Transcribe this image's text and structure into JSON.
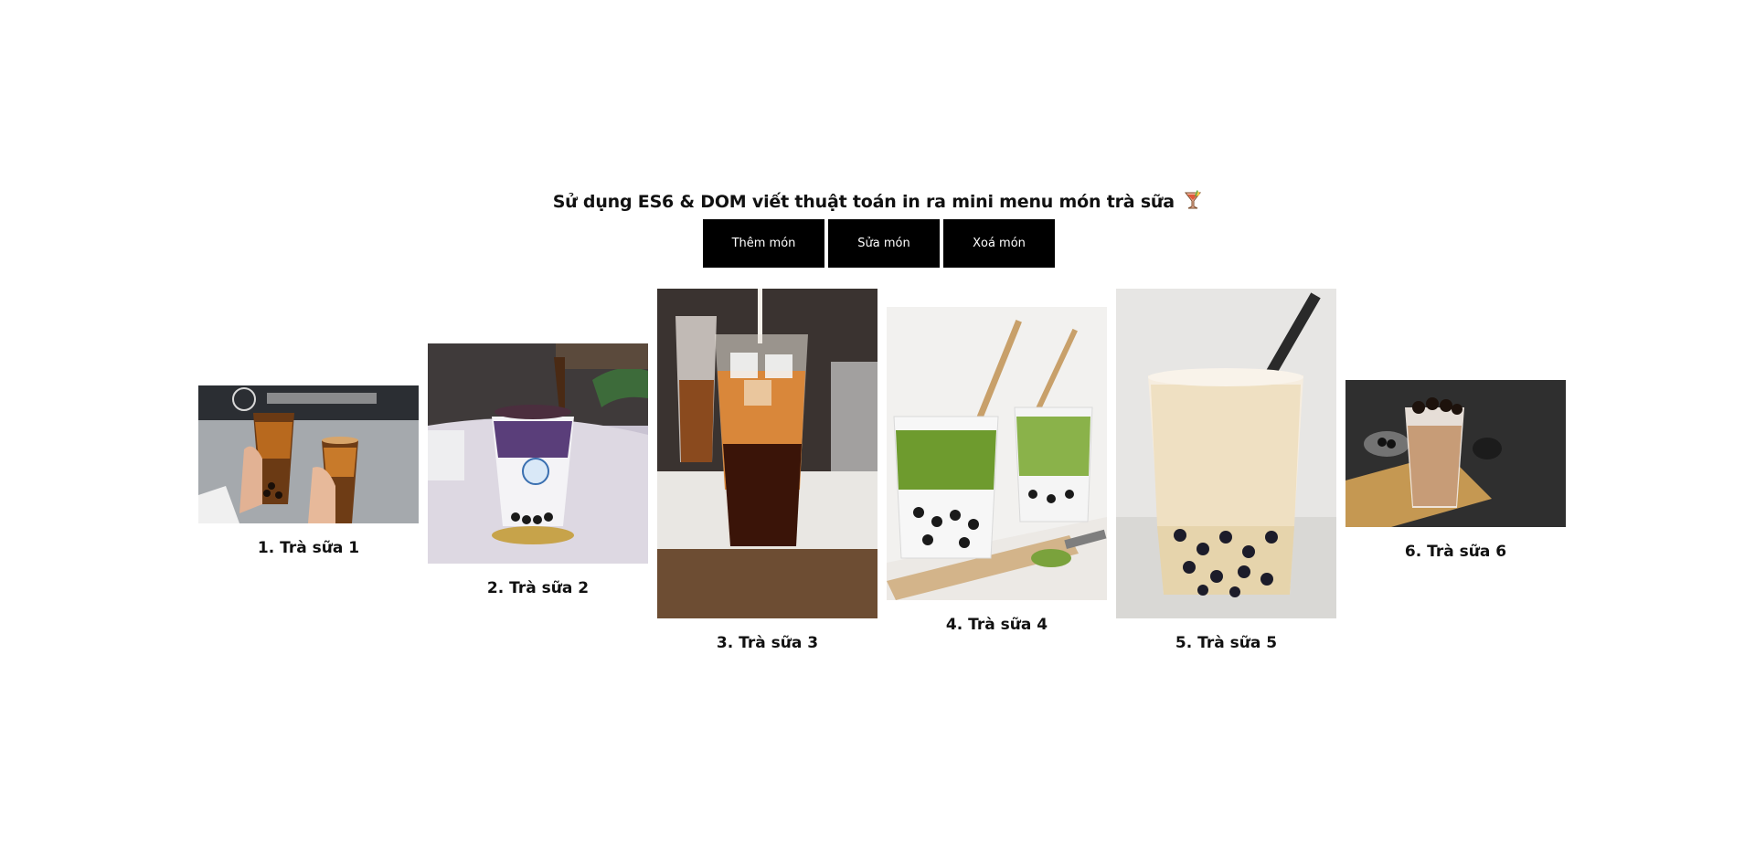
{
  "header": {
    "title": "Sử dụng ES6 & DOM viết thuật toán in ra mini menu món trà sữa"
  },
  "actions": {
    "add_label": "Thêm món",
    "edit_label": "Sửa món",
    "delete_label": "Xoá món"
  },
  "menu": {
    "items": [
      {
        "label": "1. Trà sữa 1"
      },
      {
        "label": "2. Trà sữa 2"
      },
      {
        "label": "3. Trà sữa 3"
      },
      {
        "label": "4. Trà sữa 4"
      },
      {
        "label": "5. Trà sữa 5"
      },
      {
        "label": "6. Trà sữa 6"
      }
    ]
  },
  "colors": {
    "button_bg": "#000000",
    "button_text": "#ffffff",
    "page_bg": "#ffffff"
  },
  "icons": {
    "title_icon": "cocktail-glass-icon"
  }
}
